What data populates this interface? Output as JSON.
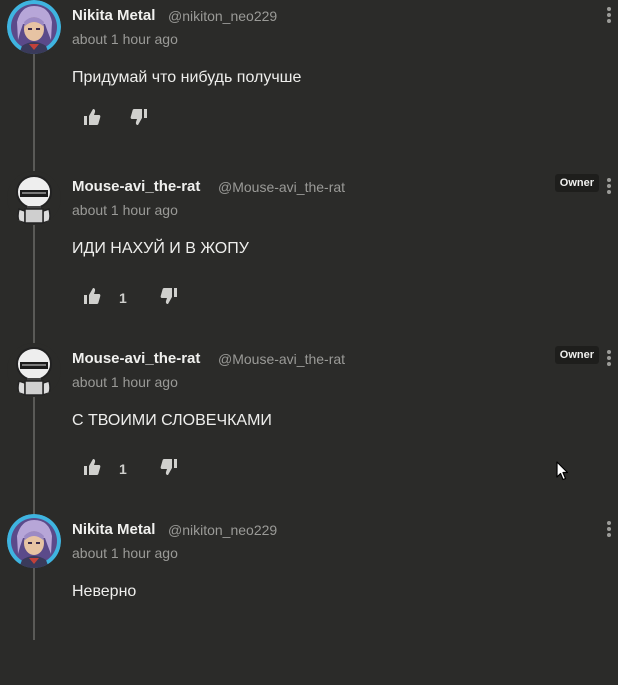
{
  "comments": [
    {
      "author": "Nikita Metal",
      "handle": "@nikiton_neo229",
      "time": "about 1 hour ago",
      "text": "Придумай что нибудь получше",
      "likes": "",
      "owner": "",
      "avatar": "anime-avatar"
    },
    {
      "author": "Mouse-avi_the-rat",
      "handle": "@Mouse-avi_the-rat",
      "time": "about 1 hour ago",
      "text": "ИДИ НАХУЙ И В ЖОПУ",
      "likes": "1",
      "owner": "Owner",
      "avatar": "robot-avatar"
    },
    {
      "author": "Mouse-avi_the-rat",
      "handle": "@Mouse-avi_the-rat",
      "time": "about 1 hour ago",
      "text": "С ТВОИМИ СЛОВЕЧКАМИ",
      "likes": "1",
      "owner": "Owner",
      "avatar": "robot-avatar"
    },
    {
      "author": "Nikita Metal",
      "handle": "@nikiton_neo229",
      "time": "about 1 hour ago",
      "text": "Неверно",
      "likes": "",
      "owner": "",
      "avatar": "anime-avatar"
    }
  ],
  "icons": {
    "like": "thumbs-up-icon",
    "dislike": "thumbs-down-icon",
    "menu": "more-vertical-icon",
    "cursor": "mouse-cursor-icon"
  },
  "colors": {
    "background": "#2b2b29",
    "text": "#eeeeec",
    "muted": "#9a9a97",
    "badge": "#1e1e1c"
  }
}
